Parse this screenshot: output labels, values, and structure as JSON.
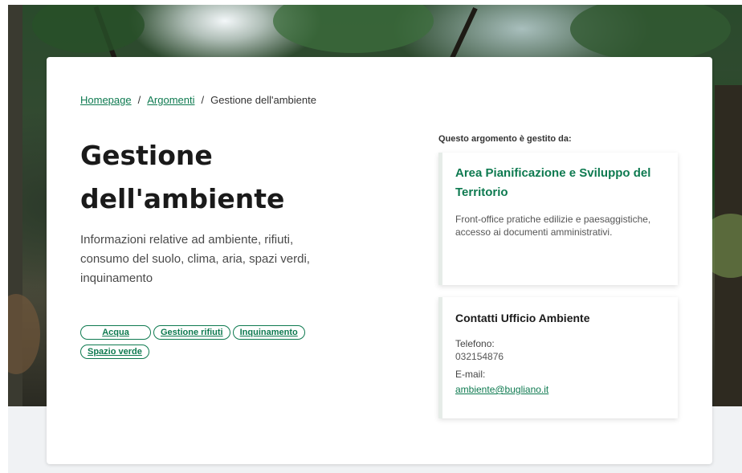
{
  "breadcrumb": {
    "home": "Homepage",
    "topics": "Argomenti",
    "current": "Gestione dell'ambiente",
    "separator": "/"
  },
  "topic": {
    "title": "Gestione dell'ambiente",
    "description": "Informazioni relative ad ambiente, rifiuti, consumo del suolo, clima, aria, spazi verdi, inquinamento",
    "tags": [
      "Acqua",
      "Gestione rifiuti",
      "Inquinamento",
      "Spazio verde"
    ]
  },
  "managed_by": {
    "label": "Questo argomento è gestito da:",
    "office": {
      "title": "Area Pianificazione e Sviluppo del Territorio",
      "description": "Front-office pratiche edilizie e paesaggistiche, accesso ai documenti amministrativi."
    },
    "contacts": {
      "title": "Contatti Ufficio Ambiente",
      "phone_label": "Telefono:",
      "phone": "032154876",
      "email_label": "E-mail:",
      "email": "ambiente@bugliano.it"
    }
  },
  "colors": {
    "accent": "#0e7a50",
    "text": "#1a1a1a",
    "muted_background": "#f0f2f4"
  }
}
